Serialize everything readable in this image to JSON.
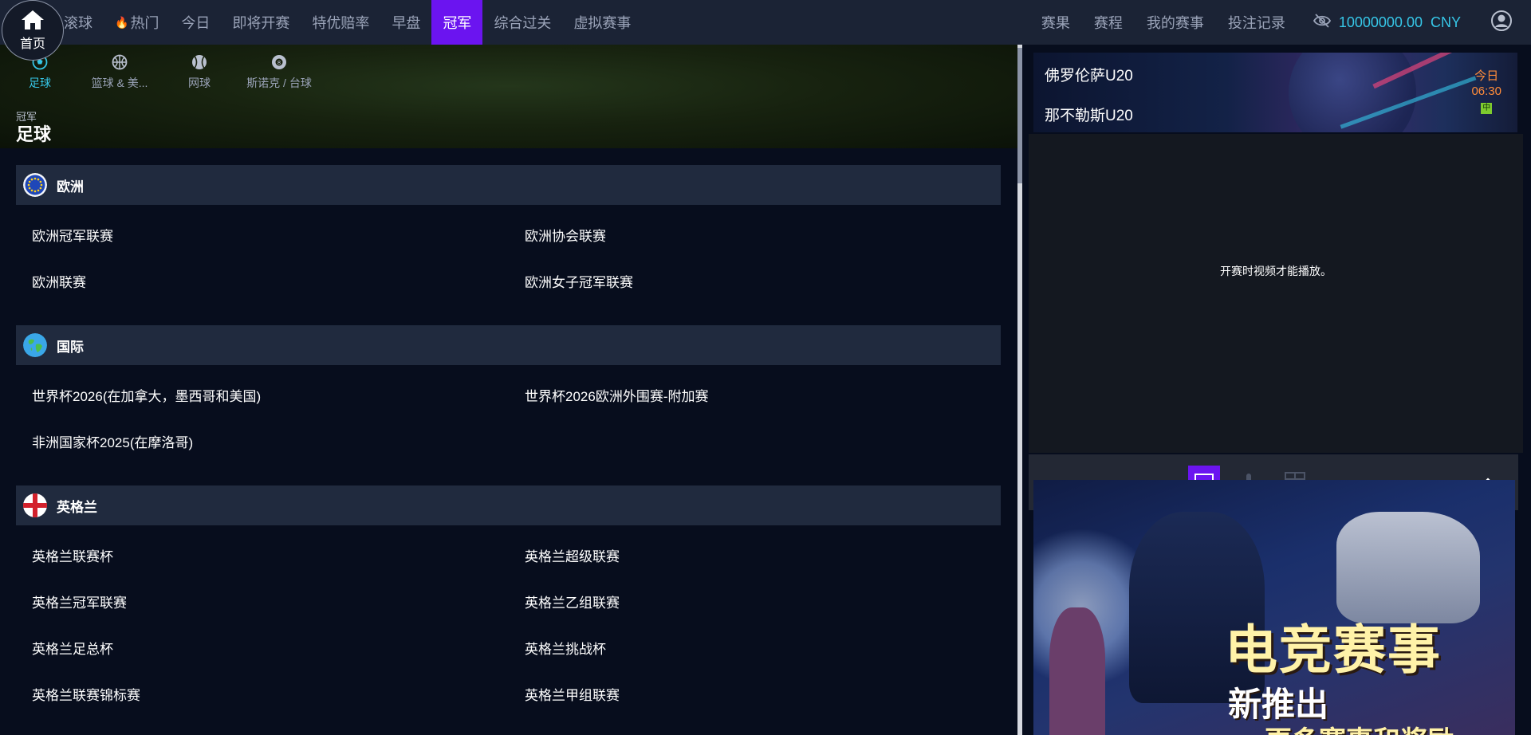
{
  "nav": {
    "home_label": "首页",
    "left_items": [
      "滚球",
      "热门",
      "今日",
      "即将开赛",
      "特优赔率",
      "早盘",
      "冠军",
      "综合过关",
      "虚拟赛事"
    ],
    "active_item": "冠军",
    "right_items": [
      "赛果",
      "赛程",
      "我的赛事",
      "投注记录"
    ],
    "balance": "10000000.00",
    "currency": "CNY"
  },
  "sport_tabs": [
    {
      "label": "足球",
      "icon": "soccer-ball-icon"
    },
    {
      "label": "篮球 & 美...",
      "icon": "basketball-icon"
    },
    {
      "label": "网球",
      "icon": "tennis-ball-icon"
    },
    {
      "label": "斯诺克 / 台球",
      "icon": "billiard-ball-icon"
    }
  ],
  "hero": {
    "subtitle": "冠军",
    "title": "足球"
  },
  "regions": [
    {
      "name": "欧洲",
      "flag": "eu-flag-icon",
      "leagues": [
        "欧洲冠军联赛",
        "欧洲协会联赛",
        "欧洲联赛",
        "欧洲女子冠军联赛"
      ]
    },
    {
      "name": "国际",
      "flag": "globe-icon",
      "leagues": [
        "世界杯2026(在加拿大，墨西哥和美国)",
        "世界杯2026欧洲外围赛-附加赛",
        "非洲国家杯2025(在摩洛哥)"
      ]
    },
    {
      "name": "英格兰",
      "flag": "england-flag-icon",
      "leagues": [
        "英格兰联赛杯",
        "英格兰超级联赛",
        "英格兰冠军联赛",
        "英格兰乙组联赛",
        "英格兰足总杯",
        "英格兰挑战杯",
        "英格兰联赛锦标赛",
        "英格兰甲组联赛"
      ]
    }
  ],
  "match": {
    "home": "佛罗伦萨U20",
    "away": "那不勒斯U20",
    "day": "今日",
    "time": "06:30",
    "badge": "中"
  },
  "video": {
    "message": "开赛时视频才能播放。"
  },
  "ad": {
    "title": "电竞赛事",
    "subtitle": "新推出",
    "subtitle2": "更多赛事和奖励"
  },
  "colors": {
    "accent": "#6b14f0",
    "balance": "#36c7e8",
    "time": "#ff8c3a"
  }
}
